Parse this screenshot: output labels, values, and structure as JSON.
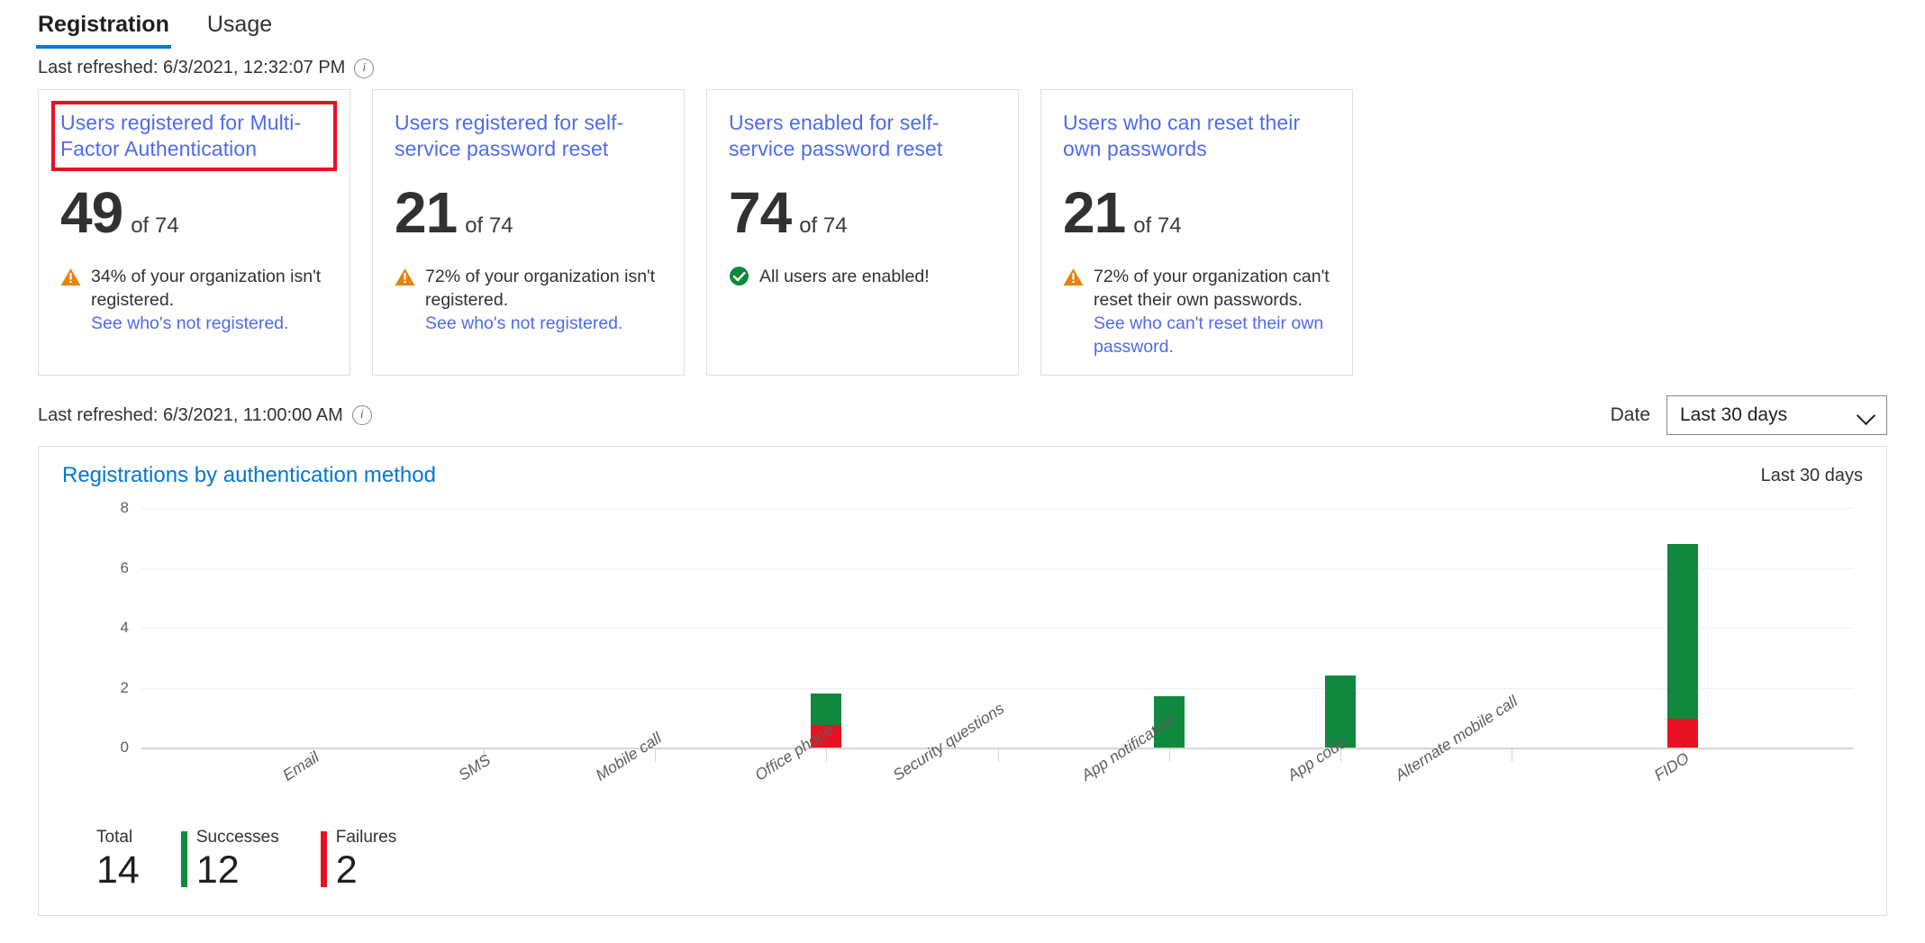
{
  "tabs": [
    {
      "label": "Registration",
      "active": true
    },
    {
      "label": "Usage",
      "active": false
    }
  ],
  "top_refresh": {
    "text": "Last refreshed: 6/3/2021, 12:32:07 PM",
    "info_icon": "info-icon"
  },
  "cards": [
    {
      "title": "Users registered for Multi-Factor Authentication",
      "highlighted": true,
      "value": "49",
      "of": "of 74",
      "status": "warning",
      "status_icon": "warning-triangle-icon",
      "note": "34% of your organization isn't registered.",
      "link": "See who's not registered."
    },
    {
      "title": "Users registered for self-service password reset",
      "highlighted": false,
      "value": "21",
      "of": "of 74",
      "status": "warning",
      "status_icon": "warning-triangle-icon",
      "note": "72% of your organization isn't registered.",
      "link": "See who's not registered."
    },
    {
      "title": "Users enabled for self-service password reset",
      "highlighted": false,
      "value": "74",
      "of": "of 74",
      "status": "ok",
      "status_icon": "check-circle-icon",
      "note": "All users are enabled!",
      "link": ""
    },
    {
      "title": "Users who can reset their own passwords",
      "highlighted": false,
      "value": "21",
      "of": "of 74",
      "status": "warning",
      "status_icon": "warning-triangle-icon",
      "note": "72% of your organization can't reset their own passwords.",
      "link": "See who can't reset their own password."
    }
  ],
  "chart_refresh": {
    "text": "Last refreshed: 6/3/2021, 11:00:00 AM",
    "info_icon": "info-icon"
  },
  "date_filter": {
    "label": "Date",
    "value": "Last 30 days",
    "chevron_icon": "chevron-down-icon"
  },
  "chart_panel": {
    "title": "Registrations by authentication method",
    "range": "Last 30 days"
  },
  "chart_data": {
    "type": "bar",
    "title": "Registrations by authentication method",
    "xlabel": "",
    "ylabel": "",
    "ylim": [
      0,
      8
    ],
    "yticks": [
      0,
      2,
      4,
      6,
      8
    ],
    "grid": true,
    "stacked": true,
    "legend_position": "bottom-left",
    "categories": [
      "Email",
      "SMS",
      "Mobile call",
      "Office phone",
      "Security questions",
      "App notification",
      "App code",
      "Alternate mobile call",
      "FIDO"
    ],
    "series": [
      {
        "name": "Failures",
        "color": "#e81123",
        "values": [
          0,
          0,
          0,
          0.75,
          0,
          0,
          0,
          0,
          0.95
        ]
      },
      {
        "name": "Successes",
        "color": "#10893e",
        "values": [
          0,
          0,
          0,
          1.05,
          0,
          1.7,
          2.4,
          0,
          5.85
        ]
      }
    ],
    "totals": [
      0,
      0,
      0,
      1.8,
      0,
      1.7,
      2.4,
      0,
      6.8
    ]
  },
  "legend": [
    {
      "label": "Total",
      "value": "14",
      "color": "",
      "swatch": false
    },
    {
      "label": "Successes",
      "value": "12",
      "color": "#10893e",
      "swatch": true
    },
    {
      "label": "Failures",
      "value": "2",
      "color": "#e81123",
      "swatch": true
    }
  ]
}
